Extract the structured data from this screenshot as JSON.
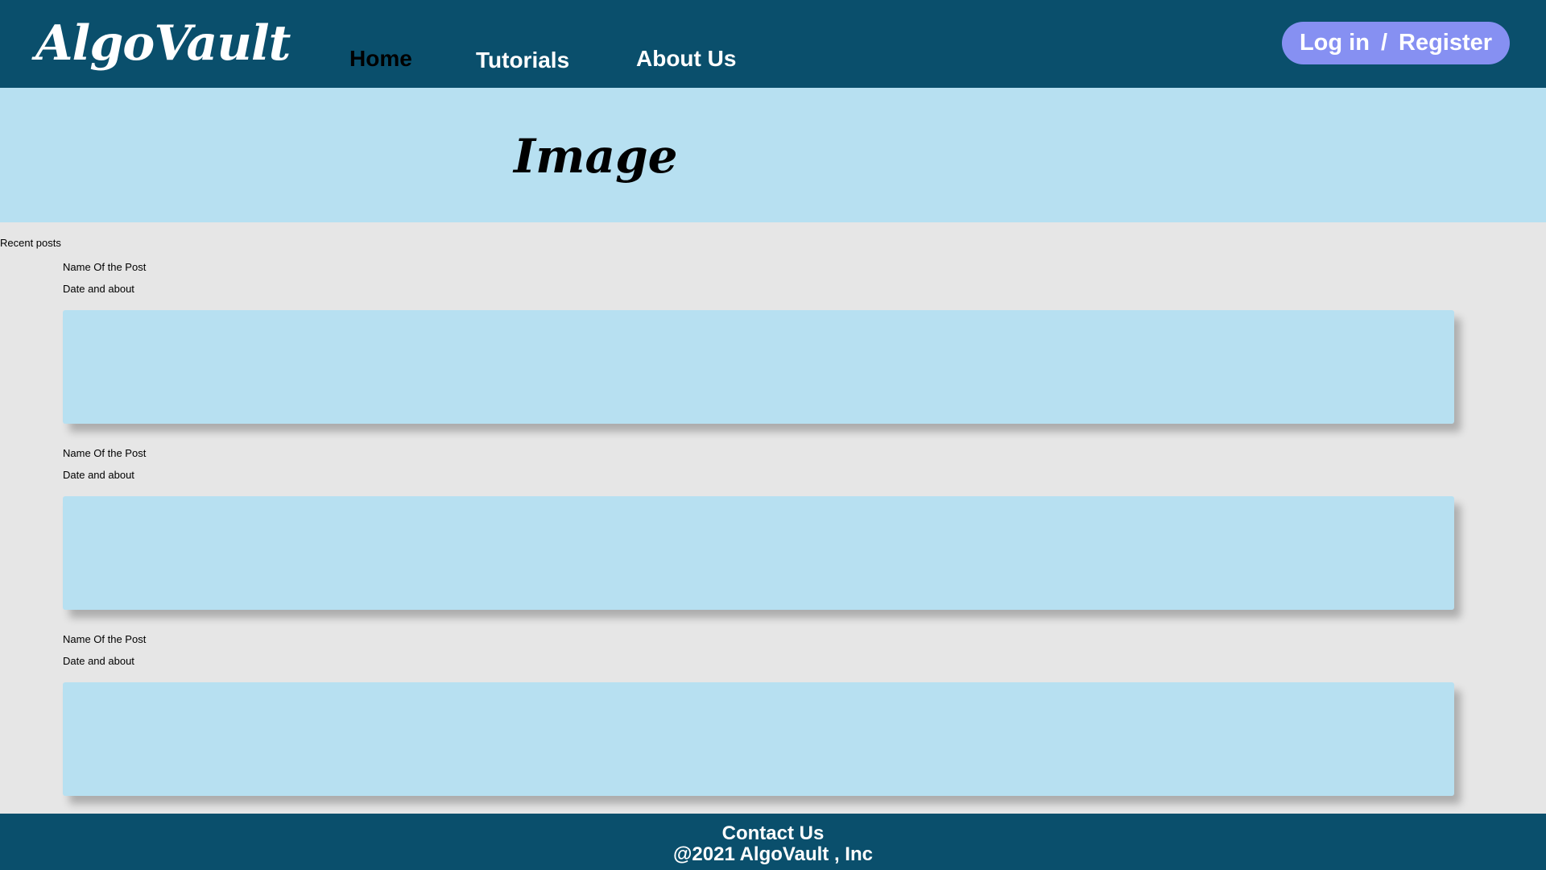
{
  "header": {
    "logo": "AlgoVault",
    "nav": [
      {
        "label": "Home",
        "active": true
      },
      {
        "label": "Tutorials",
        "active": false
      },
      {
        "label": "About Us",
        "active": false
      }
    ],
    "auth": {
      "login": "Log in",
      "separator": "/",
      "register": "Register"
    }
  },
  "hero": {
    "title": "Image"
  },
  "main": {
    "recent_label": "Recent posts",
    "posts": [
      {
        "name": "Name Of the Post",
        "meta": "Date  and about"
      },
      {
        "name": "Name Of the Post",
        "meta": "Date  and about"
      },
      {
        "name": "Name Of the Post",
        "meta": "Date  and about"
      }
    ]
  },
  "footer": {
    "contact": "Contact Us",
    "copyright": "@2021 AlgoVault , Inc"
  },
  "colors": {
    "header_bg": "#0a4f6c",
    "accent_button": "#8690f2",
    "light_blue": "#b7e0f1",
    "page_bg": "#e6e6e6"
  }
}
